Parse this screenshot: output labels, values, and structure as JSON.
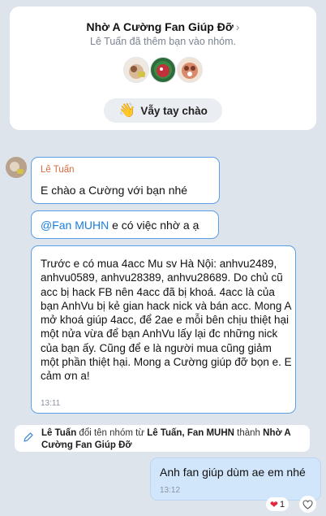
{
  "group_card": {
    "title": "Nhờ A Cường Fan Giúp Đỡ",
    "title_chevron": "›",
    "subtitle": "Lê Tuấn đã thêm bạn vào nhóm.",
    "avatars": [
      "member-avatar-1",
      "member-avatar-2",
      "member-avatar-3"
    ],
    "wave_button": {
      "icon": "👋",
      "label": "Vẫy tay chào"
    }
  },
  "messages": [
    {
      "sender": "Lê Tuấn",
      "text": "E chào a Cường với bạn nhé"
    },
    {
      "mention": "@Fan MUHN",
      "text_after_mention": " e có việc nhờ a ạ"
    },
    {
      "text": "Trước e có mua 4acc Mu sv Hà Nội: anhvu2489, anhvu0589, anhvu28389, anhvu28689. Do chủ cũ acc bị hack FB nên 4acc đã bị khoá. 4acc là của bạn AnhVu bị kẻ gian hack nick và bán acc. Mong A mở khoá giúp 4acc, để 2ae e mỗi bên chịu thiệt hại một nửa vừa để bạn AnhVu lấy lại đc những nick của bạn ấy. Cũng để e là người mua cũng giảm một phần thiệt hại. Mong a Cường giúp đỡ bọn e. E cảm ơn a!",
      "time": "13:11"
    }
  ],
  "system_message": {
    "actor": "Lê Tuấn",
    "verb": " đổi tên nhóm từ ",
    "old_name": "Lê Tuấn, Fan MUHN",
    "connector": " thành ",
    "new_name": "Nhờ A Cường Fan Giúp Đỡ"
  },
  "my_message": {
    "text": "Anh fan giúp dùm ae em nhé",
    "time": "13:12"
  },
  "reaction": {
    "icon": "❤",
    "count": "1"
  },
  "colors": {
    "background": "#dde4ec",
    "bubble_border": "#5aa0e6",
    "mine_bubble": "#d2e6fb",
    "sender_name": "#d96a3a",
    "mention": "#1b7ee0"
  }
}
